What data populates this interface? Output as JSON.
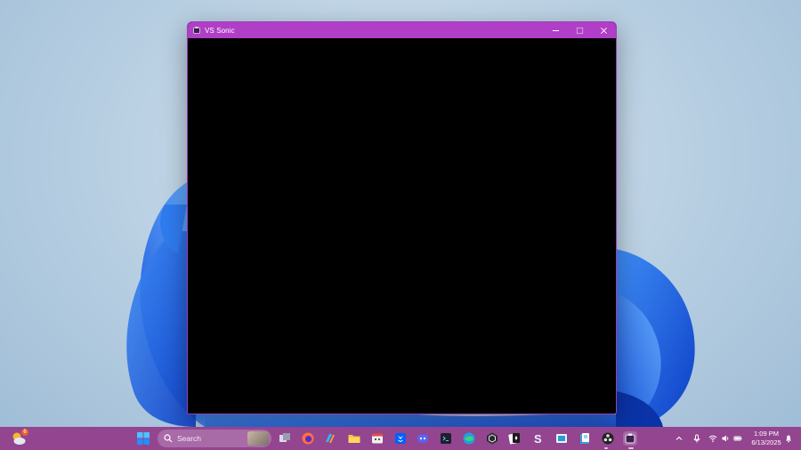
{
  "window": {
    "title": "VS Sonic",
    "controls": {
      "minimize": "minimize-icon",
      "maximize": "maximize-icon",
      "close": "close-icon"
    }
  },
  "taskbar": {
    "widget_badge": "6",
    "search_placeholder": "Search",
    "pinned_apps": [
      "start-icon",
      "task-view-icon",
      "firefox-icon",
      "copilot-icon",
      "file-explorer-icon",
      "calendar-icon",
      "dropbox-icon",
      "discord-icon",
      "terminal-icon",
      "edge-icon",
      "unity-icon",
      "solitaire-icon",
      "simplenote-icon",
      "window-app-icon",
      "books-icon",
      "obs-icon",
      "vs-sonic-icon"
    ],
    "tray_icons": [
      "chevron-up-icon",
      "microphone-icon",
      "wifi-icon",
      "volume-icon",
      "battery-icon"
    ],
    "clock": {
      "time": "1:09 PM",
      "date": "6/13/2025"
    }
  },
  "colors": {
    "titlebar": "#b03ec6",
    "taskbar": "#93458f",
    "client": "#000000"
  }
}
